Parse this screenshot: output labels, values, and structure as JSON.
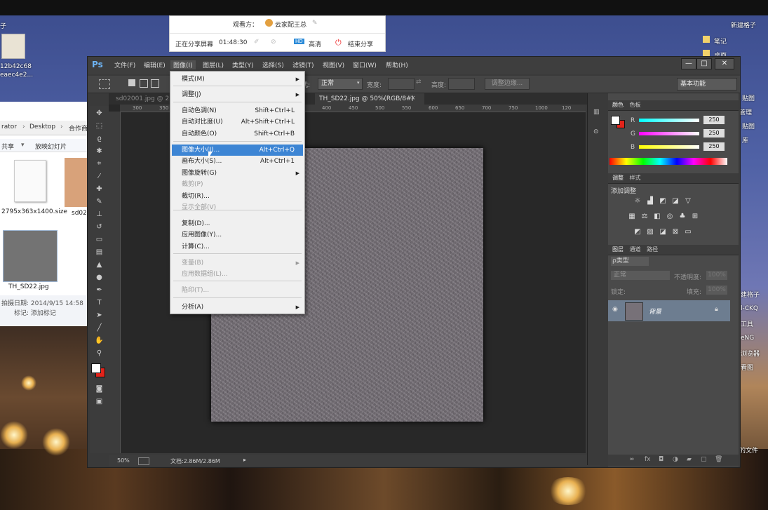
{
  "desktop": {
    "top_left_label": "子",
    "icon1_lines": [
      "12b42c68",
      "eaec4e2..."
    ],
    "right_labels": [
      "新建格子",
      "笔记",
      "桌面",
      "管理",
      "贴图",
      "库",
      "建格子",
      "l-CKQ",
      "工具",
      "eNG",
      "浏览器",
      "看图",
      "的文件"
    ]
  },
  "explorer": {
    "path": [
      "rator",
      "Desktop",
      "合作商"
    ],
    "toolbar": [
      "共享",
      "放映幻灯片"
    ],
    "file1_name": "2795x363x1400.size",
    "file2_name": "sd02",
    "file3_name": "TH_SD22.jpg",
    "date_label": "拍摄日期: 2014/9/15 14:58",
    "tag_label": "标记: 添加标记"
  },
  "share_panel": {
    "viewer_label": "观看方：",
    "viewer_name": "云家配王总",
    "status": "正在分享屏幕",
    "time": "01:48:30",
    "hd_badge": "HD",
    "hd_label": "高清",
    "end_label": "结束分享"
  },
  "photoshop": {
    "logo": "Ps",
    "menus": [
      "文件(F)",
      "编辑(E)",
      "图像(I)",
      "图层(L)",
      "类型(Y)",
      "选择(S)",
      "滤镜(T)",
      "视图(V)",
      "窗口(W)",
      "帮助(H)"
    ],
    "window_controls": [
      "—",
      "□",
      "✕"
    ],
    "options": {
      "style_label": "式:",
      "style_value": "正常",
      "width_label": "宽度:",
      "height_label": "高度:",
      "refine_button": "调整边缘...",
      "workspace": "基本功能"
    },
    "tabs": [
      "sd02001.jpg @ 25",
      "TH_SD22.jpg @ 50%(RGB/8#)"
    ],
    "tab_close": "×",
    "ruler_ticks": [
      "300",
      "350",
      "400",
      "450",
      "500",
      "550",
      "600",
      "650",
      "700",
      "750",
      "800",
      "850",
      "900",
      "950",
      "1000",
      "1050",
      "1100",
      "1150",
      "1200",
      "120"
    ],
    "zoom": "50%",
    "doc_info": "文档:2.86M/2.86M",
    "panels": {
      "color_tabs": [
        "颜色",
        "色板"
      ],
      "rgb": [
        {
          "label": "R",
          "value": "250"
        },
        {
          "label": "G",
          "value": "250"
        },
        {
          "label": "B",
          "value": "250"
        }
      ],
      "adjust_tabs": [
        "调整",
        "样式"
      ],
      "adjust_title": "添加调整",
      "layers_tabs": [
        "图层",
        "通道",
        "路径"
      ],
      "kind_label": "ρ类型",
      "blend_mode": "正常",
      "opacity_label": "不透明度:",
      "opacity_value": "100%",
      "lock_label": "锁定:",
      "fill_label": "填充:",
      "fill_value": "100%",
      "layer_name": "背景"
    }
  },
  "image_menu": {
    "items": [
      {
        "label": "模式(M)",
        "shortcut": "",
        "submenu": true,
        "disabled": false
      },
      {
        "label": "调整(J)",
        "shortcut": "",
        "submenu": true,
        "disabled": false
      },
      {
        "label": "自动色调(N)",
        "shortcut": "Shift+Ctrl+L",
        "submenu": false,
        "disabled": false
      },
      {
        "label": "自动对比度(U)",
        "shortcut": "Alt+Shift+Ctrl+L",
        "submenu": false,
        "disabled": false
      },
      {
        "label": "自动颜色(O)",
        "shortcut": "Shift+Ctrl+B",
        "submenu": false,
        "disabled": false
      },
      {
        "label": "图像大小(I)...",
        "shortcut": "Alt+Ctrl+Q",
        "submenu": false,
        "disabled": false,
        "highlighted": true
      },
      {
        "label": "画布大小(S)...",
        "shortcut": "Alt+Ctrl+1",
        "submenu": false,
        "disabled": false
      },
      {
        "label": "图像旋转(G)",
        "shortcut": "",
        "submenu": true,
        "disabled": false
      },
      {
        "label": "裁剪(P)",
        "shortcut": "",
        "submenu": false,
        "disabled": true
      },
      {
        "label": "裁切(R)...",
        "shortcut": "",
        "submenu": false,
        "disabled": false
      },
      {
        "label": "显示全部(V)",
        "shortcut": "",
        "submenu": false,
        "disabled": true
      },
      {
        "label": "复制(D)...",
        "shortcut": "",
        "submenu": false,
        "disabled": false
      },
      {
        "label": "应用图像(Y)...",
        "shortcut": "",
        "submenu": false,
        "disabled": false
      },
      {
        "label": "计算(C)...",
        "shortcut": "",
        "submenu": false,
        "disabled": false
      },
      {
        "label": "变量(B)",
        "shortcut": "",
        "submenu": true,
        "disabled": true
      },
      {
        "label": "应用数据组(L)...",
        "shortcut": "",
        "submenu": false,
        "disabled": true
      },
      {
        "label": "陷印(T)...",
        "shortcut": "",
        "submenu": false,
        "disabled": true
      },
      {
        "label": "分析(A)",
        "shortcut": "",
        "submenu": true,
        "disabled": false
      }
    ]
  },
  "colors": {
    "menu_highlight": "#3d85d4",
    "background_swatch": "#e2231a"
  }
}
